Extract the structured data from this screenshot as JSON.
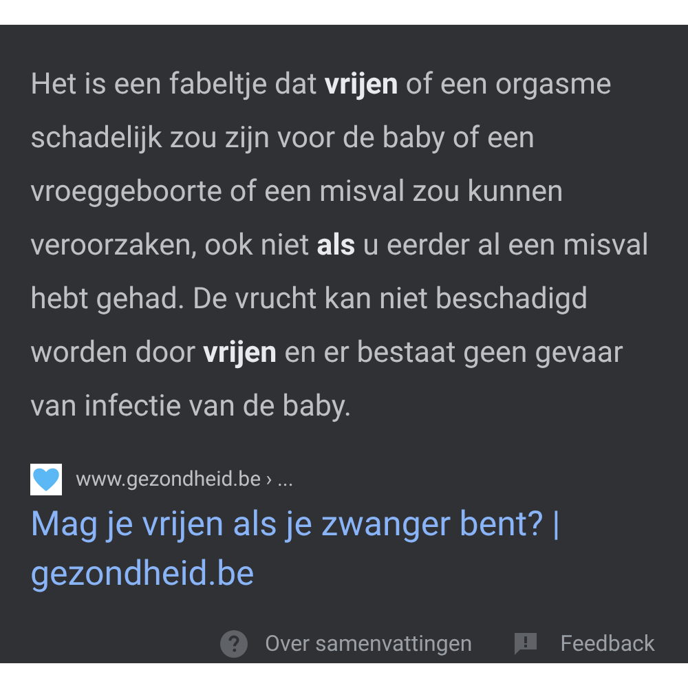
{
  "snippet": {
    "text": "Het is een fabeltje dat **vrijen** of een orgasme schadelijk zou zijn voor de baby of een vroeggeboorte of een misval zou kunnen veroorzaken, ook niet **als** u eerder al een misval hebt gehad. De vrucht kan niet beschadigd worden door **vrijen** en er bestaat geen gevaar van infectie van de baby."
  },
  "source": {
    "url": "www.gezondheid.be › ...",
    "title": "Mag je vrijen als je zwanger bent? | gezondheid.be"
  },
  "footer": {
    "about": "Over samenvattingen",
    "feedback": "Feedback"
  }
}
